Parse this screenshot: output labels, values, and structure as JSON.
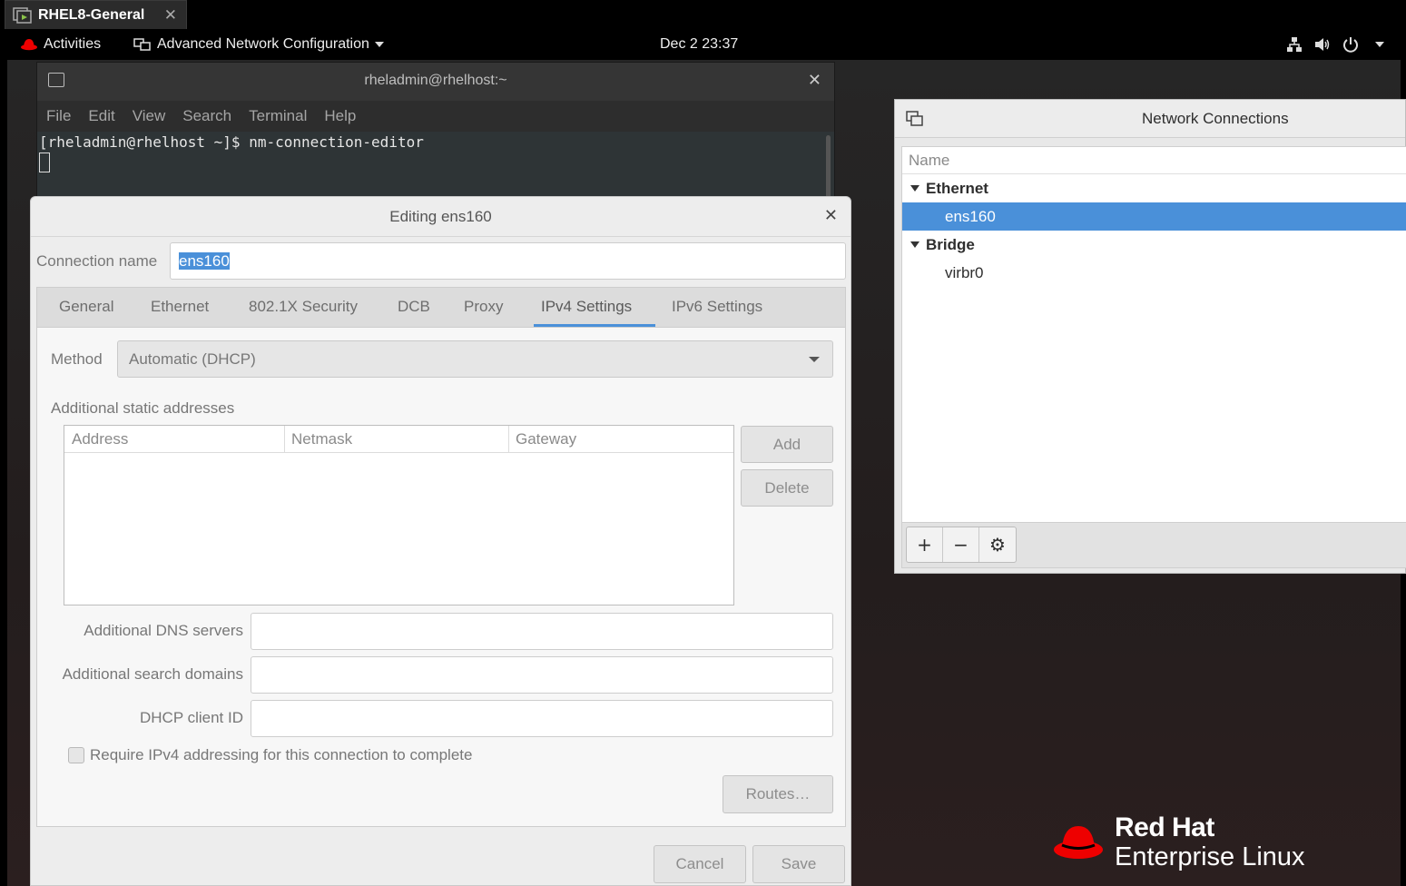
{
  "vm_tab": {
    "title": "RHEL8-General"
  },
  "topbar": {
    "activities": "Activities",
    "app_menu": "Advanced Network Configuration",
    "clock": "Dec 2  23:37"
  },
  "terminal": {
    "title": "rheladmin@rhelhost:~",
    "menu": [
      "File",
      "Edit",
      "View",
      "Search",
      "Terminal",
      "Help"
    ],
    "prompt_line": "[rheladmin@rhelhost ~]$ nm-connection-editor"
  },
  "network_connections": {
    "title": "Network Connections",
    "column_name": "Name",
    "groups": [
      {
        "label": "Ethernet",
        "items": [
          "ens160"
        ]
      },
      {
        "label": "Bridge",
        "items": [
          "virbr0"
        ]
      }
    ],
    "selected_item": "ens160"
  },
  "editor": {
    "title": "Editing ens160",
    "connection_name_label": "Connection name",
    "connection_name_value": "ens160",
    "tabs": [
      "General",
      "Ethernet",
      "802.1X Security",
      "DCB",
      "Proxy",
      "IPv4 Settings",
      "IPv6 Settings"
    ],
    "active_tab": "IPv4 Settings",
    "method_label": "Method",
    "method_value": "Automatic (DHCP)",
    "static_addresses_label": "Additional static addresses",
    "address_columns": [
      "Address",
      "Netmask",
      "Gateway"
    ],
    "add_label": "Add",
    "delete_label": "Delete",
    "dns_label": "Additional DNS servers",
    "search_domains_label": "Additional search domains",
    "dhcp_client_id_label": "DHCP client ID",
    "require_ipv4_label": "Require IPv4 addressing for this connection to complete",
    "require_ipv4_checked": false,
    "routes_label": "Routes…",
    "cancel_label": "Cancel",
    "save_label": "Save"
  },
  "branding": {
    "line1": "Red Hat",
    "line2": "Enterprise Linux"
  },
  "colors": {
    "accent": "#4a90d9",
    "brand_red": "#ee0000",
    "panel_bg": "#000000"
  }
}
